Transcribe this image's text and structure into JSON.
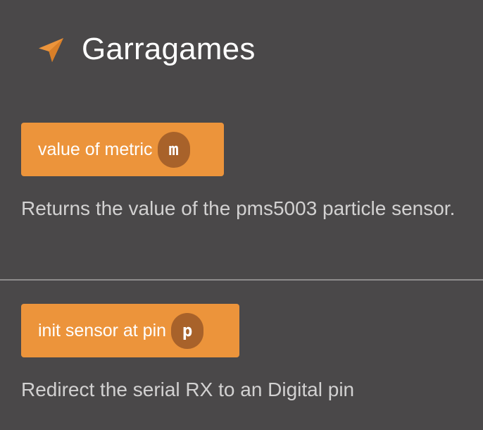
{
  "header": {
    "title": "Garragames",
    "icon": "navigation-arrow-icon",
    "icon_color": "#ec943b"
  },
  "blocks": [
    {
      "label": "value of metric",
      "param": "m",
      "description": "Returns the value of the pms5003 particle sensor."
    },
    {
      "label": "init sensor at pin",
      "param": "p",
      "description": "Redirect the serial RX to an Digital pin"
    }
  ],
  "colors": {
    "background": "#4a4849",
    "block": "#ec943b",
    "param": "#a8622a",
    "text": "#d2d1d1",
    "divider": "#8e8c8c"
  }
}
